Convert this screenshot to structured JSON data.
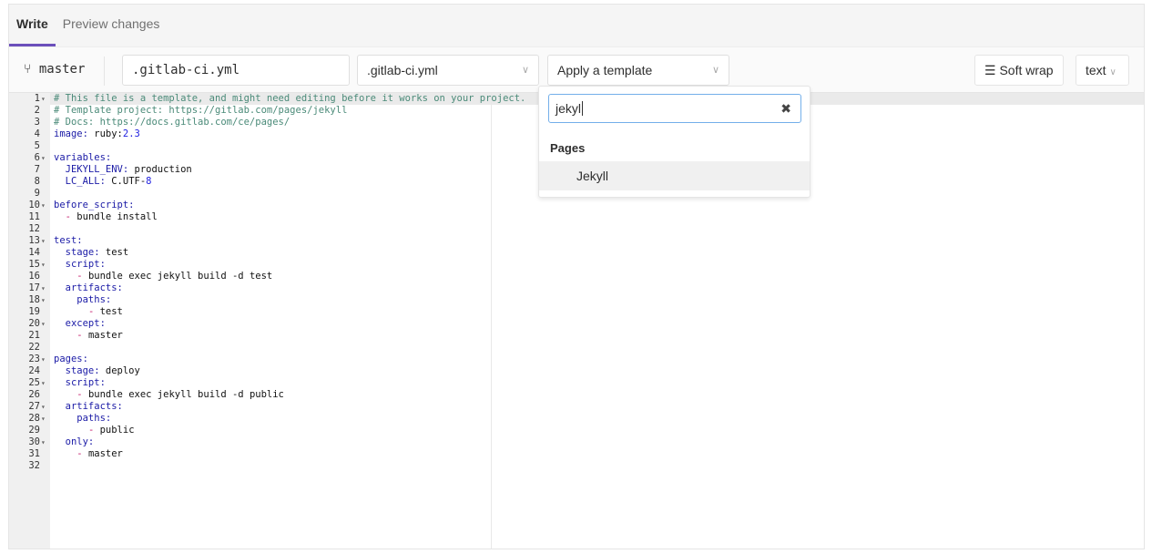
{
  "tabs": [
    {
      "label": "Write",
      "active": true
    },
    {
      "label": "Preview changes",
      "active": false
    }
  ],
  "toolbar": {
    "branch": "master",
    "file_name": ".gitlab-ci.yml",
    "file_type_select": ".gitlab-ci.yml",
    "template_select": "Apply a template",
    "soft_wrap": "Soft wrap",
    "mode_select": "text"
  },
  "dropdown": {
    "search_value": "jekyl",
    "group_header": "Pages",
    "items": [
      "Jekyll"
    ]
  },
  "colors": {
    "accent": "#6b4fbb",
    "focus": "#73afea"
  },
  "code_lines": [
    {
      "fold": true,
      "seg": [
        [
          "c",
          "# This file is a template, and might need editing before it works on your project."
        ]
      ]
    },
    {
      "fold": false,
      "seg": [
        [
          "c",
          "# Template project: https://gitlab.com/pages/jekyll"
        ]
      ]
    },
    {
      "fold": false,
      "seg": [
        [
          "c",
          "# Docs: https://docs.gitlab.com/ce/pages/"
        ]
      ]
    },
    {
      "fold": false,
      "seg": [
        [
          "k",
          "image:"
        ],
        [
          "p",
          " ruby:"
        ],
        [
          "n",
          "2.3"
        ]
      ]
    },
    {
      "fold": false,
      "seg": []
    },
    {
      "fold": true,
      "seg": [
        [
          "k",
          "variables:"
        ]
      ]
    },
    {
      "fold": false,
      "seg": [
        [
          "k",
          "  JEKYLL_ENV:"
        ],
        [
          "p",
          " production"
        ]
      ]
    },
    {
      "fold": false,
      "seg": [
        [
          "k",
          "  LC_ALL:"
        ],
        [
          "p",
          " C.UTF-"
        ],
        [
          "n",
          "8"
        ]
      ]
    },
    {
      "fold": false,
      "seg": []
    },
    {
      "fold": true,
      "seg": [
        [
          "k",
          "before_script:"
        ]
      ]
    },
    {
      "fold": false,
      "seg": [
        [
          "p",
          "  "
        ],
        [
          "d",
          "-"
        ],
        [
          "p",
          " bundle install"
        ]
      ]
    },
    {
      "fold": false,
      "seg": []
    },
    {
      "fold": true,
      "seg": [
        [
          "k",
          "test:"
        ]
      ]
    },
    {
      "fold": false,
      "seg": [
        [
          "k",
          "  stage:"
        ],
        [
          "p",
          " test"
        ]
      ]
    },
    {
      "fold": true,
      "seg": [
        [
          "k",
          "  script:"
        ]
      ]
    },
    {
      "fold": false,
      "seg": [
        [
          "p",
          "    "
        ],
        [
          "d",
          "-"
        ],
        [
          "p",
          " bundle exec jekyll build -d test"
        ]
      ]
    },
    {
      "fold": true,
      "seg": [
        [
          "k",
          "  artifacts:"
        ]
      ]
    },
    {
      "fold": true,
      "seg": [
        [
          "k",
          "    paths:"
        ]
      ]
    },
    {
      "fold": false,
      "seg": [
        [
          "p",
          "      "
        ],
        [
          "d",
          "-"
        ],
        [
          "p",
          " test"
        ]
      ]
    },
    {
      "fold": true,
      "seg": [
        [
          "k",
          "  except:"
        ]
      ]
    },
    {
      "fold": false,
      "seg": [
        [
          "p",
          "    "
        ],
        [
          "d",
          "-"
        ],
        [
          "p",
          " master"
        ]
      ]
    },
    {
      "fold": false,
      "seg": []
    },
    {
      "fold": true,
      "seg": [
        [
          "k",
          "pages:"
        ]
      ]
    },
    {
      "fold": false,
      "seg": [
        [
          "k",
          "  stage:"
        ],
        [
          "p",
          " deploy"
        ]
      ]
    },
    {
      "fold": true,
      "seg": [
        [
          "k",
          "  script:"
        ]
      ]
    },
    {
      "fold": false,
      "seg": [
        [
          "p",
          "    "
        ],
        [
          "d",
          "-"
        ],
        [
          "p",
          " bundle exec jekyll build -d public"
        ]
      ]
    },
    {
      "fold": true,
      "seg": [
        [
          "k",
          "  artifacts:"
        ]
      ]
    },
    {
      "fold": true,
      "seg": [
        [
          "k",
          "    paths:"
        ]
      ]
    },
    {
      "fold": false,
      "seg": [
        [
          "p",
          "      "
        ],
        [
          "d",
          "-"
        ],
        [
          "p",
          " public"
        ]
      ]
    },
    {
      "fold": true,
      "seg": [
        [
          "k",
          "  only:"
        ]
      ]
    },
    {
      "fold": false,
      "seg": [
        [
          "p",
          "    "
        ],
        [
          "d",
          "-"
        ],
        [
          "p",
          " master"
        ]
      ]
    },
    {
      "fold": false,
      "seg": []
    }
  ]
}
